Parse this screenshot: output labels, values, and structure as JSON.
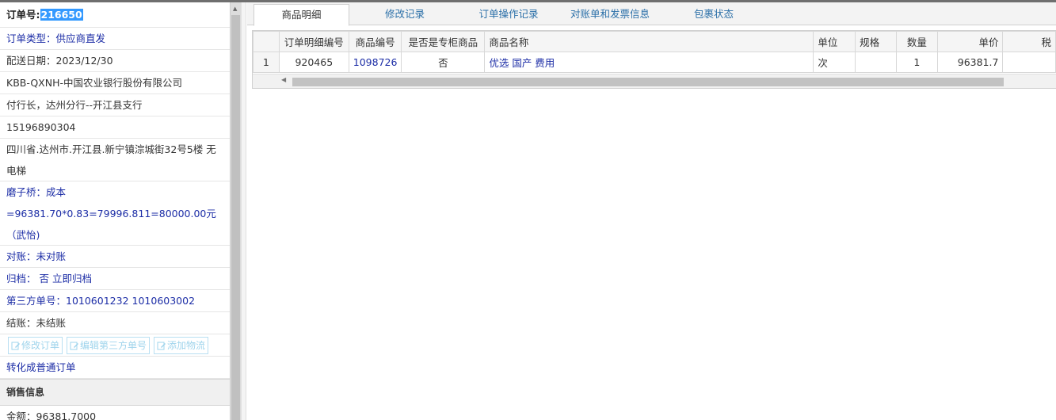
{
  "left_panel": {
    "order_no_label": "订单号:",
    "order_no_value": "216650",
    "order_type": "订单类型：供应商直发",
    "delivery_date": "配送日期：2023/12/30",
    "customer": "KBB-QXNH-中国农业银行股份有限公司",
    "contact": "付行长，达州分行--开江县支行",
    "phone": "15196890304",
    "address": "四川省.达州市.开江县.新宁镇淙城街32号5楼 无电梯",
    "note": "磨子桥：成本=96381.70*0.83=79996.811=80000.00元（武怡)",
    "reconcile": "对账：未对账",
    "archive": "归档： 否 立即归档",
    "third_party": "第三方单号：1010601232 1010603002",
    "settlement": "结账：未结账",
    "buttons": {
      "edit_order": "修改订单",
      "edit_third_party": "编辑第三方单号",
      "add_logistics": "添加物流"
    },
    "convert_link": "转化成普通订单",
    "sales_section": "销售信息",
    "amount": "金额：96381.7000"
  },
  "tabs": [
    {
      "label": "商品明细",
      "active": true
    },
    {
      "label": "修改记录",
      "active": false
    },
    {
      "label": "订单操作记录",
      "active": false
    },
    {
      "label": "对账单和发票信息",
      "active": false
    },
    {
      "label": "包裹状态",
      "active": false
    }
  ],
  "grid": {
    "headers": [
      "",
      "订单明细编号",
      "商品编号",
      "是否是专柜商品",
      "商品名称",
      "单位",
      "规格",
      "数量",
      "单价",
      "税"
    ],
    "rows": [
      [
        "1",
        "920465",
        "1098726",
        "否",
        "优选 国产 费用",
        "次",
        "",
        "1",
        "96381.7",
        ""
      ]
    ]
  },
  "colors": {
    "link_blue": "#1c2da6",
    "tab_blue": "#2a6fa8",
    "selection": "#3399ff"
  }
}
